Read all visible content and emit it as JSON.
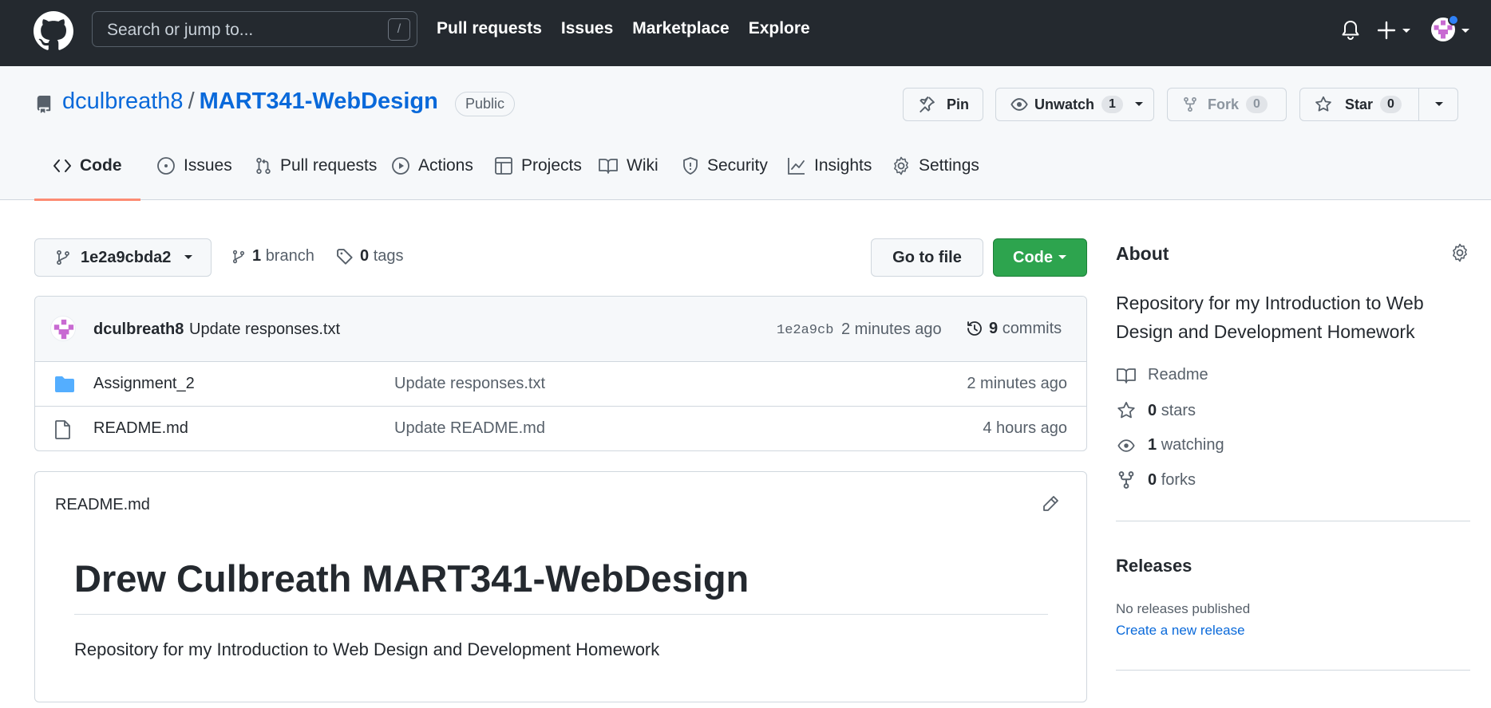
{
  "header": {
    "search_placeholder": "Search or jump to...",
    "search_shortcut": "/",
    "nav": [
      "Pull requests",
      "Issues",
      "Marketplace",
      "Explore"
    ]
  },
  "repo": {
    "owner": "dculbreath8",
    "separator": "/",
    "name": "MART341-WebDesign",
    "visibility": "Public",
    "actions": {
      "pin_label": "Pin",
      "unwatch_label": "Unwatch",
      "watch_count": "1",
      "fork_label": "Fork",
      "fork_count": "0",
      "star_label": "Star",
      "star_count": "0"
    },
    "tabs": [
      {
        "label": "Code",
        "icon": "code-icon",
        "selected": true
      },
      {
        "label": "Issues",
        "icon": "issue-icon"
      },
      {
        "label": "Pull requests",
        "icon": "pull-request-icon"
      },
      {
        "label": "Actions",
        "icon": "play-icon"
      },
      {
        "label": "Projects",
        "icon": "table-icon"
      },
      {
        "label": "Wiki",
        "icon": "book-icon"
      },
      {
        "label": "Security",
        "icon": "shield-icon"
      },
      {
        "label": "Insights",
        "icon": "graph-icon"
      },
      {
        "label": "Settings",
        "icon": "gear-icon"
      }
    ]
  },
  "toolbar": {
    "branch_ref": "1e2a9cbda2",
    "branch_count": "1",
    "branch_label": "branch",
    "tag_count": "0",
    "tag_label": "tags",
    "goto_file": "Go to file",
    "code_button": "Code"
  },
  "commit": {
    "author": "dculbreath8",
    "message": "Update responses.txt",
    "sha": "1e2a9cb",
    "time": "2 minutes ago",
    "count": "9",
    "count_label": "commits"
  },
  "files": [
    {
      "name": "Assignment_2",
      "type": "folder",
      "commit": "Update responses.txt",
      "time": "2 minutes ago"
    },
    {
      "name": "README.md",
      "type": "file",
      "commit": "Update README.md",
      "time": "4 hours ago"
    }
  ],
  "readme": {
    "filename": "README.md",
    "heading": "Drew Culbreath MART341-WebDesign",
    "body": "Repository for my Introduction to Web Design and Development Homework"
  },
  "about": {
    "title": "About",
    "description": "Repository for my Introduction to Web Design and Development Homework",
    "readme_label": "Readme",
    "stars_count": "0",
    "stars_label": "stars",
    "watching_count": "1",
    "watching_label": "watching",
    "forks_count": "0",
    "forks_label": "forks"
  },
  "releases": {
    "title": "Releases",
    "none_text": "No releases published",
    "create_link": "Create a new release"
  },
  "colors": {
    "header_bg": "#24292f",
    "link": "#0969da",
    "primary_button": "#2da44e",
    "selected_tab_underline": "#fd8c73",
    "folder": "#54aeff"
  }
}
